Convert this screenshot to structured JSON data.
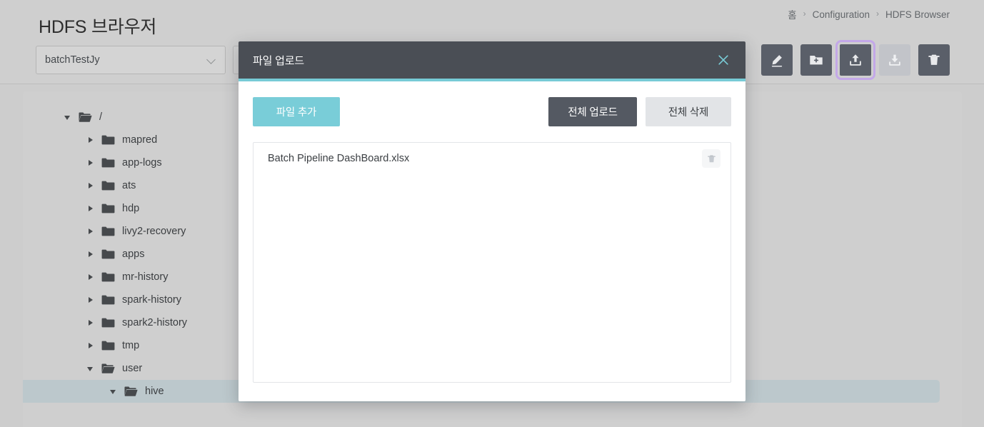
{
  "header": {
    "title": "HDFS 브라우저",
    "breadcrumb": [
      {
        "label": "홈"
      },
      {
        "label": "Configuration"
      },
      {
        "label": "HDFS Browser"
      }
    ],
    "separator": "›",
    "repo_select": {
      "value": "batchTestJy",
      "icon": "chevron-down-icon"
    },
    "toolbar": [
      {
        "name": "rename-button",
        "icon": "pencil-icon",
        "disabled": false,
        "focused": false
      },
      {
        "name": "new-folder-button",
        "icon": "folder-plus-icon",
        "disabled": false,
        "focused": false
      },
      {
        "name": "upload-button",
        "icon": "upload-icon",
        "disabled": false,
        "focused": true
      },
      {
        "name": "download-button",
        "icon": "download-icon",
        "disabled": true,
        "focused": false
      },
      {
        "name": "delete-button",
        "icon": "trash-icon",
        "disabled": false,
        "focused": false
      }
    ]
  },
  "tree": {
    "nodes": [
      {
        "label": "/",
        "depth": 0,
        "expanded": true,
        "open_folder": true,
        "selected": false
      },
      {
        "label": "mapred",
        "depth": 1,
        "expanded": false,
        "open_folder": false,
        "selected": false
      },
      {
        "label": "app-logs",
        "depth": 1,
        "expanded": false,
        "open_folder": false,
        "selected": false
      },
      {
        "label": "ats",
        "depth": 1,
        "expanded": false,
        "open_folder": false,
        "selected": false
      },
      {
        "label": "hdp",
        "depth": 1,
        "expanded": false,
        "open_folder": false,
        "selected": false
      },
      {
        "label": "livy2-recovery",
        "depth": 1,
        "expanded": false,
        "open_folder": false,
        "selected": false
      },
      {
        "label": "apps",
        "depth": 1,
        "expanded": false,
        "open_folder": false,
        "selected": false
      },
      {
        "label": "mr-history",
        "depth": 1,
        "expanded": false,
        "open_folder": false,
        "selected": false
      },
      {
        "label": "spark-history",
        "depth": 1,
        "expanded": false,
        "open_folder": false,
        "selected": false
      },
      {
        "label": "spark2-history",
        "depth": 1,
        "expanded": false,
        "open_folder": false,
        "selected": false
      },
      {
        "label": "tmp",
        "depth": 1,
        "expanded": false,
        "open_folder": false,
        "selected": false
      },
      {
        "label": "user",
        "depth": 1,
        "expanded": true,
        "open_folder": true,
        "selected": false
      },
      {
        "label": "hive",
        "depth": 2,
        "expanded": true,
        "open_folder": true,
        "selected": true
      }
    ]
  },
  "modal": {
    "title": "파일 업로드",
    "close_icon": "close-icon",
    "buttons": {
      "add_file": "파일 추가",
      "upload_all": "전체 업로드",
      "delete_all": "전체 삭제"
    },
    "files": [
      {
        "name": "Batch Pipeline DashBoard.xlsx",
        "delete_icon": "trash-icon"
      }
    ]
  },
  "colors": {
    "accent_teal": "#79cdd8",
    "header_dark": "#4a4e55",
    "page_bg": "#cdcdcd",
    "panel_bg": "#cfcfcf",
    "selected_row": "#bcc8cc",
    "focus_ring": "#c3a8e8",
    "toolbar_btn": "#5a5f69",
    "toolbar_btn_disabled": "#c2c4c9"
  }
}
